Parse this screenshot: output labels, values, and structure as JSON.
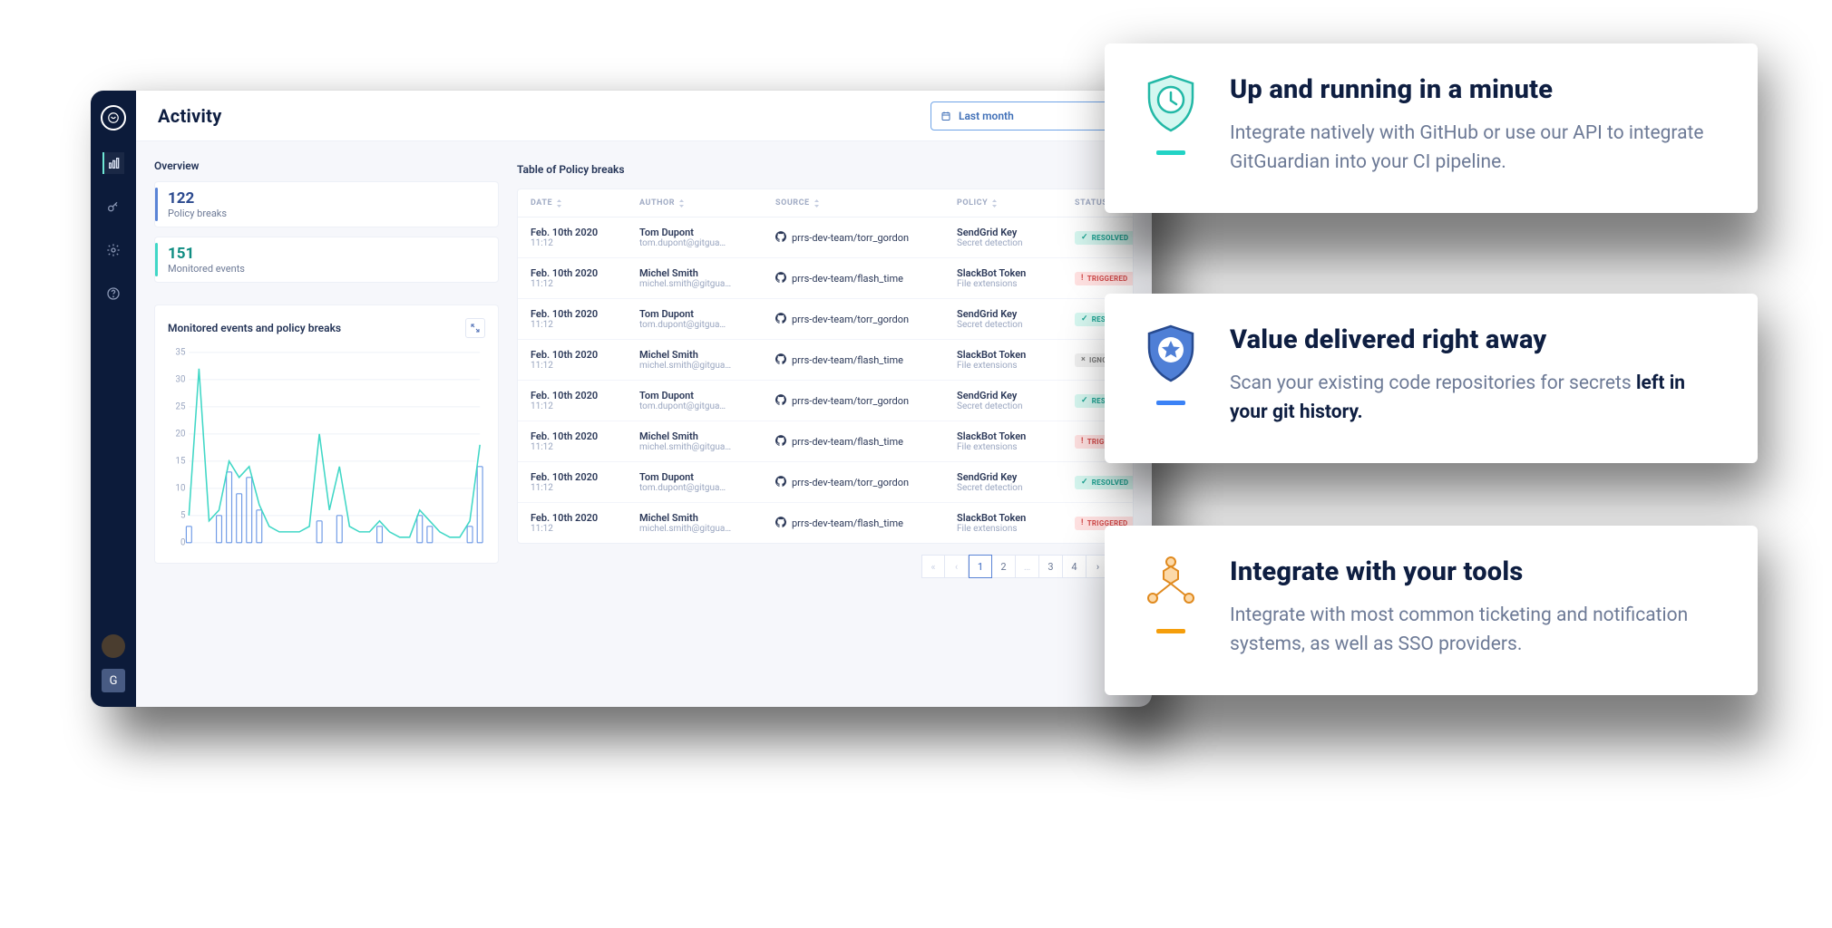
{
  "dashboard": {
    "page_title": "Activity",
    "period_selector": {
      "label": "Last month"
    },
    "overview": {
      "title": "Overview",
      "stats": [
        {
          "value": "122",
          "label": "Policy breaks",
          "color": "blue"
        },
        {
          "value": "151",
          "label": "Monitored events",
          "color": "teal"
        }
      ]
    },
    "chart": {
      "title": "Monitored events and policy breaks"
    },
    "table": {
      "title": "Table of Policy breaks",
      "columns": [
        "DATE",
        "AUTHOR",
        "SOURCE",
        "POLICY",
        "STATUS"
      ],
      "status_labels": {
        "resolved": "RESOLVED",
        "triggered": "TRIGGERED",
        "ignored": "IGNORED"
      },
      "rows": [
        {
          "date": "Feb. 10th 2020",
          "time": "11:12",
          "author": "Tom Dupont",
          "email": "tom.dupont@gitgua…",
          "source": "prrs-dev-team/torr_gordon",
          "policy": "SendGrid Key",
          "policy_sub": "Secret detection",
          "status": "resolved"
        },
        {
          "date": "Feb. 10th 2020",
          "time": "11:12",
          "author": "Michel Smith",
          "email": "michel.smith@gitgua…",
          "source": "prrs-dev-team/flash_time",
          "policy": "SlackBot Token",
          "policy_sub": "File extensions",
          "status": "triggered"
        },
        {
          "date": "Feb. 10th 2020",
          "time": "11:12",
          "author": "Tom Dupont",
          "email": "tom.dupont@gitgua…",
          "source": "prrs-dev-team/torr_gordon",
          "policy": "SendGrid Key",
          "policy_sub": "Secret detection",
          "status": "resolved"
        },
        {
          "date": "Feb. 10th 2020",
          "time": "11:12",
          "author": "Michel Smith",
          "email": "michel.smith@gitgua…",
          "source": "prrs-dev-team/flash_time",
          "policy": "SlackBot Token",
          "policy_sub": "File extensions",
          "status": "ignored"
        },
        {
          "date": "Feb. 10th 2020",
          "time": "11:12",
          "author": "Tom Dupont",
          "email": "tom.dupont@gitgua…",
          "source": "prrs-dev-team/torr_gordon",
          "policy": "SendGrid Key",
          "policy_sub": "Secret detection",
          "status": "resolved"
        },
        {
          "date": "Feb. 10th 2020",
          "time": "11:12",
          "author": "Michel Smith",
          "email": "michel.smith@gitgua…",
          "source": "prrs-dev-team/flash_time",
          "policy": "SlackBot Token",
          "policy_sub": "File extensions",
          "status": "triggered"
        },
        {
          "date": "Feb. 10th 2020",
          "time": "11:12",
          "author": "Tom Dupont",
          "email": "tom.dupont@gitgua…",
          "source": "prrs-dev-team/torr_gordon",
          "policy": "SendGrid Key",
          "policy_sub": "Secret detection",
          "status": "resolved"
        },
        {
          "date": "Feb. 10th 2020",
          "time": "11:12",
          "author": "Michel Smith",
          "email": "michel.smith@gitgua…",
          "source": "prrs-dev-team/flash_time",
          "policy": "SlackBot Token",
          "policy_sub": "File extensions",
          "status": "triggered"
        }
      ],
      "pagination": {
        "pages": [
          "1",
          "2",
          "…",
          "3",
          "4"
        ],
        "active": "1"
      }
    }
  },
  "chart_data": {
    "type": "line",
    "title": "Monitored events and policy breaks",
    "ylabel": "",
    "xlabel": "",
    "ylim": [
      0,
      35
    ],
    "yticks": [
      0,
      5,
      10,
      15,
      20,
      25,
      30,
      35
    ],
    "x": [
      0,
      1,
      2,
      3,
      4,
      5,
      6,
      7,
      8,
      9,
      10,
      11,
      12,
      13,
      14,
      15,
      16,
      17,
      18,
      19,
      20,
      21,
      22,
      23,
      24,
      25,
      26,
      27,
      28,
      29
    ],
    "series": [
      {
        "name": "Monitored events (line)",
        "color": "#40d7c6",
        "values": [
          5,
          32,
          4,
          6,
          15,
          12,
          14,
          7,
          3,
          2,
          2,
          2,
          3,
          20,
          6,
          14,
          3,
          2,
          2,
          4,
          2,
          1,
          1,
          6,
          4,
          2,
          1,
          1,
          4,
          18
        ]
      },
      {
        "name": "Policy breaks (bars)",
        "color": "#6f9ae6",
        "values": [
          3,
          0,
          0,
          5,
          13,
          9,
          12,
          6,
          0,
          0,
          0,
          0,
          0,
          4,
          0,
          5,
          0,
          0,
          0,
          3,
          0,
          0,
          0,
          5,
          3,
          0,
          0,
          0,
          3,
          14
        ]
      }
    ]
  },
  "features": [
    {
      "title": "Up and running in a minute",
      "body": "Integrate natively with GitHub or use our API to integrate GitGuardian into your CI pipeline.",
      "accent": "#22d3c5",
      "icon": "clock-shield"
    },
    {
      "title": "Value delivered right away",
      "body_prefix": "Scan your existing code repositories for secrets ",
      "body_bold": "left in your git history.",
      "accent": "#3b82f6",
      "icon": "star-shield"
    },
    {
      "title": "Integrate with your tools",
      "body": "Integrate with most common ticketing and notification systems, as well as SSO providers.",
      "accent": "#f59e0b",
      "icon": "nodes"
    }
  ],
  "colors": {
    "navy": "#0c1b3a",
    "text": "#0e1e41",
    "muted": "#6d7a96"
  }
}
